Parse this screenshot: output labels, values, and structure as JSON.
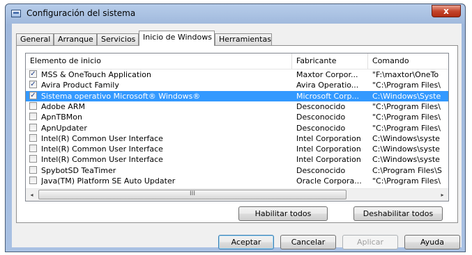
{
  "window": {
    "title": "Configuración del sistema",
    "close_glyph": "x",
    "icon": "msconfig-window-icon"
  },
  "tabs": [
    {
      "label": "General",
      "active": false
    },
    {
      "label": "Arranque",
      "active": false
    },
    {
      "label": "Servicios",
      "active": false
    },
    {
      "label": "Inicio de Windows",
      "active": true
    },
    {
      "label": "Herramientas",
      "active": false
    }
  ],
  "list": {
    "columns": [
      "Elemento de inicio",
      "Fabricante",
      "Comando"
    ],
    "rows": [
      {
        "checked": true,
        "selected": false,
        "name": "MSS & OneTouch Application",
        "maker": "Maxtor Corpor...",
        "command": "\"F:\\maxtor\\OneTo"
      },
      {
        "checked": true,
        "selected": false,
        "name": "Avira Product Family",
        "maker": "Avira Operatio...",
        "command": "\"C:\\Program Files\\"
      },
      {
        "checked": true,
        "selected": true,
        "name": "Sistema operativo Microsoft® Windows®",
        "maker": "Microsoft Corp...",
        "command": "C:\\Windows\\Syste"
      },
      {
        "checked": false,
        "selected": false,
        "name": "Adobe ARM",
        "maker": "Desconocido",
        "command": "\"C:\\Program Files\\"
      },
      {
        "checked": false,
        "selected": false,
        "name": "ApnTBMon",
        "maker": "Desconocido",
        "command": "\"C:\\Program Files\\"
      },
      {
        "checked": false,
        "selected": false,
        "name": "ApnUpdater",
        "maker": "Desconocido",
        "command": "\"C:\\Program Files\\"
      },
      {
        "checked": false,
        "selected": false,
        "name": "Intel(R) Common User Interface",
        "maker": "Intel Corporation",
        "command": "C:\\Windows\\syste"
      },
      {
        "checked": false,
        "selected": false,
        "name": "Intel(R) Common User Interface",
        "maker": "Intel Corporation",
        "command": "C:\\Windows\\syste"
      },
      {
        "checked": false,
        "selected": false,
        "name": "Intel(R) Common User Interface",
        "maker": "Intel Corporation",
        "command": "C:\\Windows\\syste"
      },
      {
        "checked": false,
        "selected": false,
        "name": "SpybotSD TeaTimer",
        "maker": "Desconocido",
        "command": "C:\\Program Files\\S"
      },
      {
        "checked": false,
        "selected": false,
        "name": "Java(TM) Platform SE Auto Updater",
        "maker": "Oracle Corpora...",
        "command": "\"C:\\Program Files\\"
      }
    ],
    "scroll_left": "◂",
    "scroll_right": "▸",
    "scroll_grip": "III"
  },
  "panel_buttons": {
    "enable_all": "Habilitar todos",
    "disable_all": "Deshabilitar todos"
  },
  "dialog_buttons": {
    "ok": "Aceptar",
    "cancel": "Cancelar",
    "apply": "Aplicar",
    "help": "Ayuda"
  },
  "colors": {
    "selection": "#3399ff",
    "frame": "#a9c1e3"
  }
}
